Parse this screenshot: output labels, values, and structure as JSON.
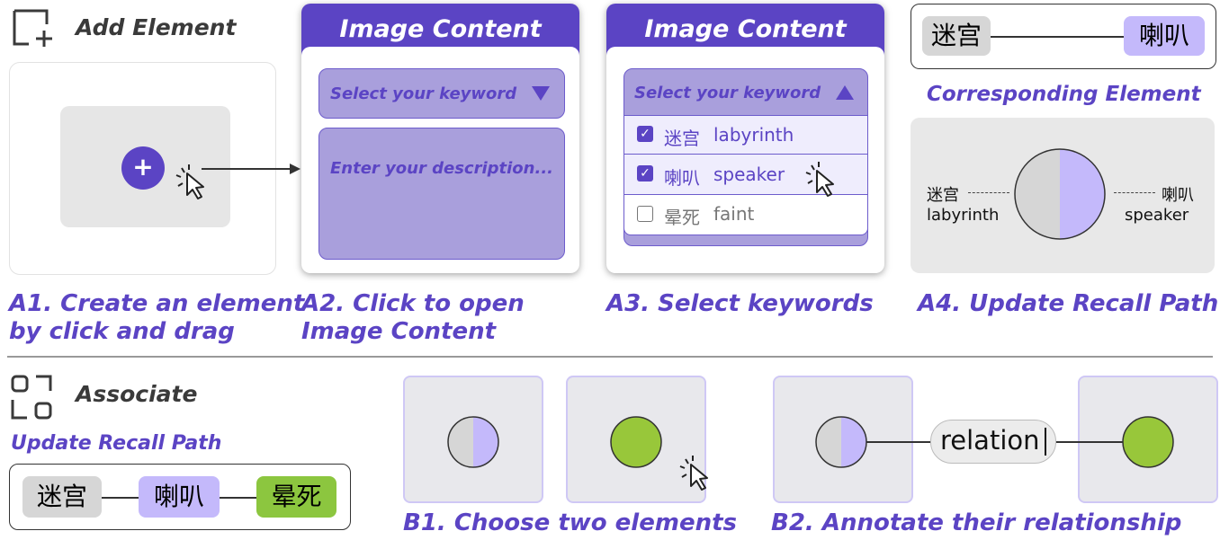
{
  "section_a": {
    "header": "Add Element",
    "panel_title_a2": "Image Content",
    "panel_title_a3": "Image Content",
    "select_placeholder_a2": "Select your keyword",
    "select_placeholder_a3": "Select your keyword",
    "description_placeholder": "Enter your description...",
    "keywords": [
      {
        "zh": "迷宫",
        "en": "labyrinth",
        "checked": true
      },
      {
        "zh": "喇叭",
        "en": "speaker",
        "checked": true
      },
      {
        "zh": "晕死",
        "en": "faint",
        "checked": false
      }
    ],
    "top_path": {
      "left": "迷宫",
      "right": "喇叭"
    },
    "corresponding_label": "Corresponding Element",
    "element_left_zh": "迷宫",
    "element_left_en": "labyrinth",
    "element_right_zh": "喇叭",
    "element_right_en": "speaker",
    "plus_symbol": "+",
    "captions": {
      "a1_line1": "A1. Create an element",
      "a1_line2": "by click and drag",
      "a2_line1": "A2. Click to open",
      "a2_line2": "Image Content",
      "a3": "A3. Select keywords",
      "a4": "A4. Update Recall Path"
    }
  },
  "section_b": {
    "header": "Associate",
    "update_label": "Update Recall Path",
    "path": [
      "迷宫",
      "喇叭",
      "晕死"
    ],
    "relation_text": "relation",
    "captions": {
      "b1": "B1. Choose two elements",
      "b2": "B2. Annotate their relationship"
    }
  },
  "colors": {
    "accent": "#5b44c4",
    "lavender": "#c4b9fb",
    "panel_fill": "#a99fdc",
    "gray_tag": "#d6d6d6",
    "green": "#8cc63f",
    "green_dot": "#98c73a"
  },
  "icons": [
    "add-element-icon",
    "associate-icon",
    "cursor-icon",
    "checkbox-icon",
    "caret-down-icon",
    "caret-up-icon"
  ]
}
